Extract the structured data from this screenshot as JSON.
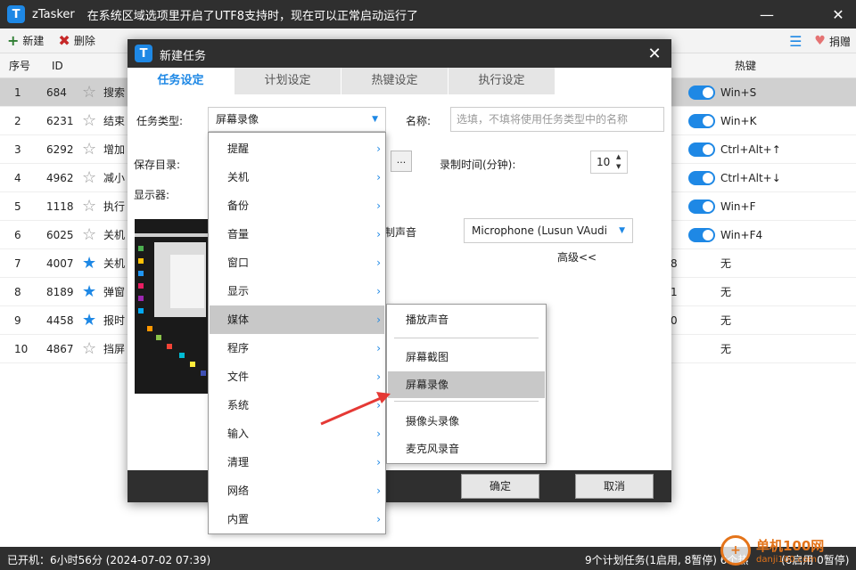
{
  "window": {
    "app_name": "zTasker",
    "notice": "在系统区域选项里开启了UTF8支持时，现在可以正常启动运行了",
    "minimize": "—",
    "close": "✕"
  },
  "toolbar": {
    "new_label": "新建",
    "delete_label": "删除",
    "list_icon": "list-icon",
    "donate_label": "捐赠"
  },
  "table": {
    "headers": {
      "index": "序号",
      "id": "ID",
      "hotkey": "热键"
    },
    "rows": [
      {
        "index": "1",
        "id": "684",
        "name": "搜索",
        "starred": false,
        "toggle": true,
        "extra": "",
        "hotkey": "Win+S",
        "selected": true
      },
      {
        "index": "2",
        "id": "6231",
        "name": "结束",
        "starred": false,
        "toggle": true,
        "extra": "",
        "hotkey": "Win+K",
        "selected": false
      },
      {
        "index": "3",
        "id": "6292",
        "name": "增加",
        "starred": false,
        "toggle": true,
        "extra": "",
        "hotkey": "Ctrl+Alt+↑",
        "selected": false
      },
      {
        "index": "4",
        "id": "4962",
        "name": "减小",
        "starred": false,
        "toggle": true,
        "extra": "",
        "hotkey": "Ctrl+Alt+↓",
        "selected": false
      },
      {
        "index": "5",
        "id": "1118",
        "name": "执行",
        "starred": false,
        "toggle": true,
        "extra": "",
        "hotkey": "Win+F",
        "selected": false
      },
      {
        "index": "6",
        "id": "6025",
        "name": "关机",
        "starred": false,
        "toggle": true,
        "extra": "",
        "hotkey": "Win+F4",
        "selected": false
      },
      {
        "index": "7",
        "id": "4007",
        "name": "关机",
        "starred": true,
        "toggle": false,
        "extra": "8",
        "hotkey": "无",
        "selected": false
      },
      {
        "index": "8",
        "id": "8189",
        "name": "弹窗",
        "starred": true,
        "toggle": false,
        "extra": "1",
        "hotkey": "无",
        "selected": false
      },
      {
        "index": "9",
        "id": "4458",
        "name": "报时",
        "starred": true,
        "toggle": false,
        "extra": "0",
        "hotkey": "无",
        "selected": false
      },
      {
        "index": "10",
        "id": "4867",
        "name": "挡屏",
        "starred": false,
        "toggle": false,
        "extra": "",
        "hotkey": "无",
        "selected": false
      }
    ]
  },
  "status": {
    "uptime": "已开机：6小时56分 (2024-07-02 07:39)",
    "summary": "9个计划任务(1启用, 8暂停)  6个热",
    "summary2": "(6启用 0暂停)"
  },
  "watermark": {
    "text": "单机100网",
    "sub": "danji100.com"
  },
  "dialog": {
    "title": "新建任务",
    "close": "✕",
    "tabs": [
      "任务设定",
      "计划设定",
      "热键设定",
      "执行设定"
    ],
    "task_type_label": "任务类型:",
    "task_type_value": "屏幕录像",
    "name_label": "名称:",
    "name_placeholder": "选填，不填将使用任务类型中的名称",
    "save_dir_label": "保存目录:",
    "browse_label": "...",
    "record_time_label": "录制时间(分钟):",
    "record_time_value": "10",
    "display_label": "显示器:",
    "audio_label": "制声音",
    "audio_device": "Microphone (Lusun VAudi",
    "advanced_label": "高级<<",
    "ok_label": "确定",
    "cancel_label": "取消"
  },
  "menu": {
    "items": [
      {
        "label": "提醒",
        "highlighted": false
      },
      {
        "label": "关机",
        "highlighted": false
      },
      {
        "label": "备份",
        "highlighted": false
      },
      {
        "label": "音量",
        "highlighted": false
      },
      {
        "label": "窗口",
        "highlighted": false
      },
      {
        "label": "显示",
        "highlighted": false
      },
      {
        "label": "媒体",
        "highlighted": true
      },
      {
        "label": "程序",
        "highlighted": false
      },
      {
        "label": "文件",
        "highlighted": false
      },
      {
        "label": "系统",
        "highlighted": false
      },
      {
        "label": "输入",
        "highlighted": false
      },
      {
        "label": "清理",
        "highlighted": false
      },
      {
        "label": "网络",
        "highlighted": false
      },
      {
        "label": "内置",
        "highlighted": false
      }
    ]
  },
  "submenu": {
    "items": [
      {
        "label": "播放声音",
        "highlighted": false
      },
      {
        "label": "屏幕截图",
        "highlighted": false
      },
      {
        "label": "屏幕录像",
        "highlighted": true
      },
      {
        "label": "摄像头录像",
        "highlighted": false
      },
      {
        "label": "麦克风录音",
        "highlighted": false
      }
    ]
  },
  "colors": {
    "accent": "#1e88e5",
    "dark": "#2f2f2f",
    "arrow": "#e53935",
    "watermark": "#e4741a"
  }
}
